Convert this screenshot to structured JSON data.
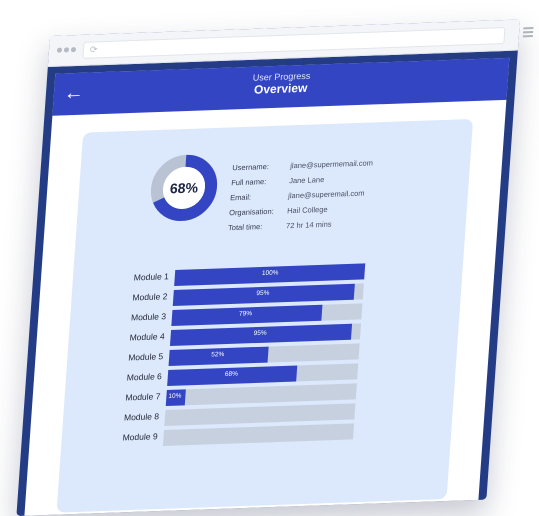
{
  "browser": {
    "address_icon": "⟳"
  },
  "header": {
    "subtitle": "User Progress",
    "title": "Overview"
  },
  "progress": {
    "overall": 0.68,
    "overall_label": "68%"
  },
  "profile": [
    {
      "key": "Username:",
      "value": "jlane@supermemail.com"
    },
    {
      "key": "Full name:",
      "value": "Jane Lane"
    },
    {
      "key": "Email:",
      "value": "jlane@superemail.com"
    },
    {
      "key": "Organisation:",
      "value": "Hail College"
    },
    {
      "key": "Total time:",
      "value": "72 hr 14 mins"
    }
  ],
  "modules": [
    {
      "label": "Module 1",
      "value": 1.0,
      "pct_label": "100%"
    },
    {
      "label": "Module 2",
      "value": 0.95,
      "pct_label": "95%"
    },
    {
      "label": "Module 3",
      "value": 0.79,
      "pct_label": "79%"
    },
    {
      "label": "Module 4",
      "value": 0.95,
      "pct_label": "95%"
    },
    {
      "label": "Module 5",
      "value": 0.52,
      "pct_label": "52%"
    },
    {
      "label": "Module 6",
      "value": 0.68,
      "pct_label": "68%"
    },
    {
      "label": "Module 7",
      "value": 0.1,
      "pct_label": "10%"
    },
    {
      "label": "Module 8",
      "value": 0,
      "pct_label": ""
    },
    {
      "label": "Module 9",
      "value": 0,
      "pct_label": ""
    }
  ],
  "colors": {
    "accent": "#3345c3",
    "frame": "#243c86",
    "track": "#c7d0de",
    "card": "#dce8fb"
  }
}
